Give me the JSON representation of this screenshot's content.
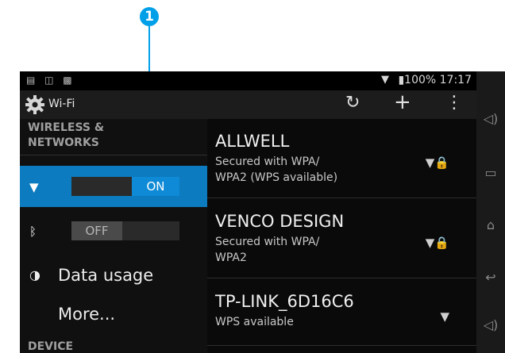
{
  "annotation": {
    "number": "1"
  },
  "statusbar": {
    "icons": "▤ ◫ ▩",
    "wifi": "▼",
    "battery_text": "▮100%",
    "time": "17:17"
  },
  "actionbar": {
    "title": "Wi-Fi",
    "refresh_glyph": "↻",
    "add_glyph": "+",
    "overflow_glyph": "⋮"
  },
  "left": {
    "wireless_header": "WIRELESS & NETWORKS",
    "wifi": {
      "toggle_state": "ON"
    },
    "bluetooth": {
      "toggle_state": "OFF"
    },
    "data_usage": "Data usage",
    "more": "More...",
    "device_header": "DEVICE"
  },
  "networks": [
    {
      "name": "ALLWELL",
      "status": "Secured with WPA/\nWPA2 (WPS available)"
    },
    {
      "name": "VENCO DESIGN",
      "status": "Secured with WPA/\nWPA2"
    },
    {
      "name": "TP-LINK_6D16C6",
      "status": "WPS available"
    }
  ],
  "colors": {
    "accent": "#0e8ad6",
    "annotation": "#00a0e9"
  }
}
